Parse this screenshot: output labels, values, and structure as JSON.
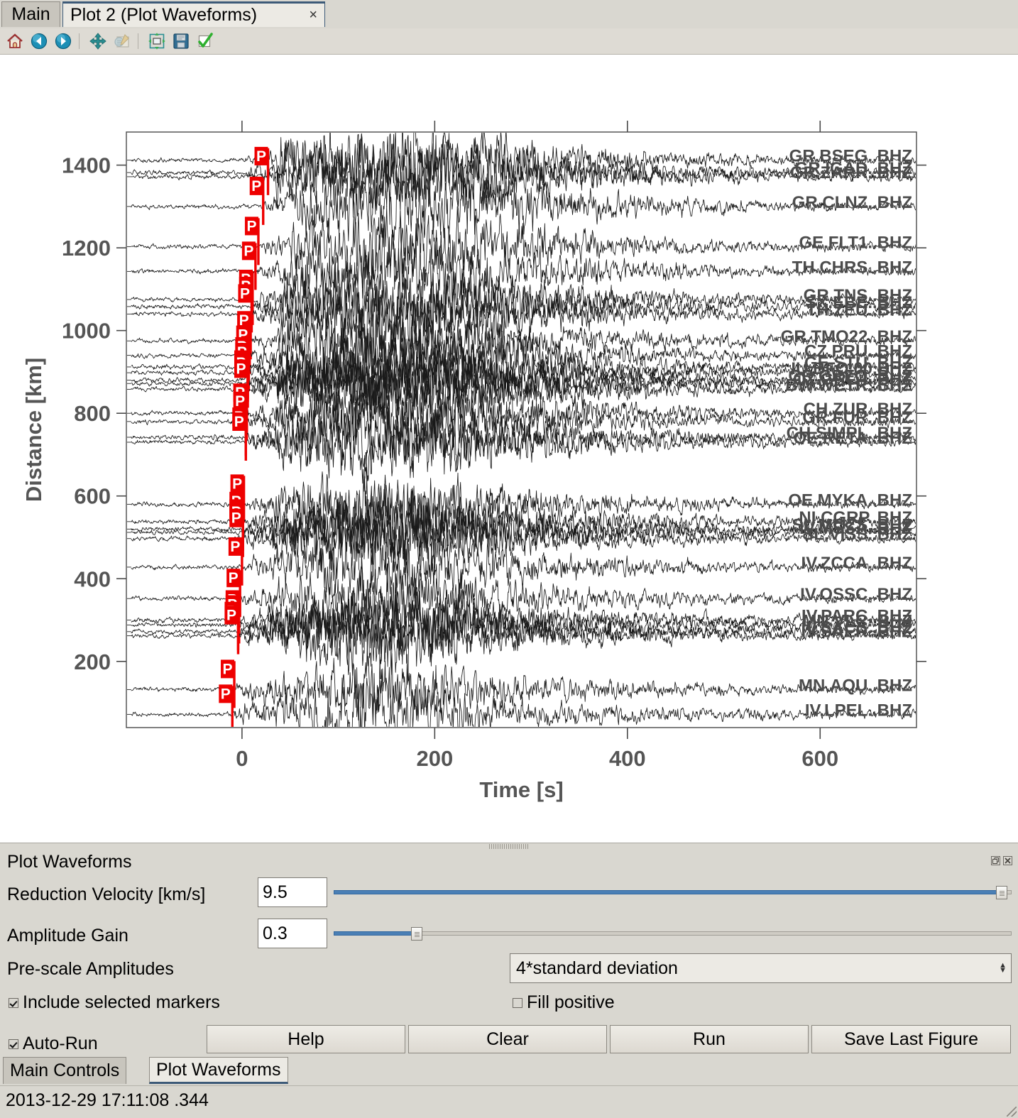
{
  "window": {
    "tabs": [
      {
        "id": "main",
        "label": "Main",
        "active": false
      },
      {
        "id": "plot2",
        "label": "Plot 2 (Plot Waveforms)",
        "active": true,
        "close": "×"
      }
    ]
  },
  "toolbar": {
    "items": [
      {
        "name": "home-icon",
        "title": "Home"
      },
      {
        "name": "back-arrow-icon",
        "title": "Back"
      },
      {
        "name": "forward-arrow-icon",
        "title": "Forward"
      },
      {
        "name": "pan-move-icon",
        "title": "Pan"
      },
      {
        "name": "edit-configure-icon",
        "title": "Configure subplots"
      },
      {
        "name": "zoom-fit-icon",
        "title": "Zoom to rectangle"
      },
      {
        "name": "save-floppy-icon",
        "title": "Save figure"
      },
      {
        "name": "apply-check-icon",
        "title": "Apply"
      }
    ]
  },
  "chart_data": {
    "type": "line",
    "title": "",
    "xlabel": "Time [s]",
    "ylabel": "Distance [km]",
    "xlim": [
      -120,
      700
    ],
    "ylim": [
      40,
      1480
    ],
    "xticks": [
      0,
      200,
      400,
      600
    ],
    "yticks": [
      200,
      400,
      600,
      800,
      1000,
      1200,
      1400
    ],
    "grid": false,
    "legend_position": "right-inline-labels",
    "marker_phase_label": "P",
    "marker_color": "#ee0000",
    "trace_color": "#1a1a1a",
    "label_color": "#4c4c4c",
    "traces": [
      {
        "label": "GR.BSEG..BHZ",
        "distance": 1412,
        "pick": null
      },
      {
        "label": "GR.IGAD..BHZ",
        "distance": 1382,
        "pick": null
      },
      {
        "label": "GR.ZARR..BHZ",
        "distance": 1372,
        "pick": 27
      },
      {
        "label": "GR.CLNZ..BHZ",
        "distance": 1300,
        "pick": 22
      },
      {
        "label": "GE.FLT1..BHZ",
        "distance": 1203,
        "pick": 17
      },
      {
        "label": "TH.CHRS..BHZ",
        "distance": 1143,
        "pick": 14
      },
      {
        "label": "GR.TNS..BHZ",
        "distance": 1075,
        "pick": 11
      },
      {
        "label": "SX.EBE..BHZ",
        "distance": 1058,
        "pick": 11
      },
      {
        "label": "TH.ZEU..BHZ",
        "distance": 1040,
        "pick": 10
      },
      {
        "label": "GR.TMO22..BHZ",
        "distance": 975,
        "pick": 9
      },
      {
        "label": "CZ.PRU..BHZ",
        "distance": 940,
        "pick": 8
      },
      {
        "label": "GE.STU..BHZ",
        "distance": 912,
        "pick": 7
      },
      {
        "label": "IU.BFO.00.BHZ",
        "distance": 898,
        "pick": 7
      },
      {
        "label": "GR.GRFO..BHZ",
        "distance": 880,
        "pick": 6
      },
      {
        "label": "CZ.GRC4..BHZ",
        "distance": 872,
        "pick": 6
      },
      {
        "label": "BW.WETR..BHZ",
        "distance": 858,
        "pick": 6
      },
      {
        "label": "CH.ZUR..BHZ",
        "distance": 800,
        "pick": 5
      },
      {
        "label": "GR.FUR..BHZ",
        "distance": 780,
        "pick": 5
      },
      {
        "label": "CH.SIMPL..BHZ",
        "distance": 742,
        "pick": 4
      },
      {
        "label": "OE.RETA..BHZ",
        "distance": 730,
        "pick": 4
      },
      {
        "label": "OE.MYKA..BHZ",
        "distance": 580,
        "pick": 2
      },
      {
        "label": "NI.CGRP..BHZ",
        "distance": 538,
        "pick": 1
      },
      {
        "label": "SL.MOZS..BHZ",
        "distance": 520,
        "pick": 1
      },
      {
        "label": "IV.MSSA..BHZ",
        "distance": 512,
        "pick": 1
      },
      {
        "label": "SL.VISS..BHZ",
        "distance": 497,
        "pick": 1
      },
      {
        "label": "IV.ZCCA..BHZ",
        "distance": 428,
        "pick": 0
      },
      {
        "label": "IV.OSSC..BHZ",
        "distance": 352,
        "pick": -2
      },
      {
        "label": "IV.PARC..BHZ",
        "distance": 300,
        "pick": -3
      },
      {
        "label": "MN.VLC..BHZ",
        "distance": 288,
        "pick": -3
      },
      {
        "label": "IV.SACS..BHZ",
        "distance": 272,
        "pick": -4
      },
      {
        "label": "IV.SAER..BHZ",
        "distance": 262,
        "pick": -4
      },
      {
        "label": "MN.AQU..BHZ",
        "distance": 132,
        "pick": -8
      },
      {
        "label": "IV.LPEL..BHZ",
        "distance": 72,
        "pick": -10
      }
    ]
  },
  "panel": {
    "title": "Plot Waveforms",
    "float_button": "float",
    "close_button": "close",
    "reduction_velocity": {
      "label": "Reduction Velocity [km/s]",
      "value": "9.5",
      "slider_fraction": 0.985
    },
    "amplitude_gain": {
      "label": "Amplitude Gain",
      "value": "0.3",
      "slider_fraction": 0.122
    },
    "prescale": {
      "label": "Pre-scale Amplitudes",
      "value": "4*standard deviation",
      "up_arrow": "▲",
      "down_arrow": "▼"
    },
    "include_markers": {
      "label": "Include selected markers",
      "checked": true
    },
    "fill_positive": {
      "label": "Fill positive",
      "checked": false
    },
    "auto_run": {
      "label": "Auto-Run",
      "checked": true
    },
    "buttons": [
      {
        "name": "help-button",
        "label": "Help"
      },
      {
        "name": "clear-button",
        "label": "Clear"
      },
      {
        "name": "run-button",
        "label": "Run"
      },
      {
        "name": "save-last-figure-button",
        "label": "Save Last Figure"
      }
    ]
  },
  "bottom_tabs": [
    {
      "id": "main-controls",
      "label": "Main Controls",
      "active": false
    },
    {
      "id": "plot-waveforms",
      "label": "Plot Waveforms",
      "active": true
    }
  ],
  "status": {
    "text": "2013-12-29 17:11:08 .344"
  }
}
